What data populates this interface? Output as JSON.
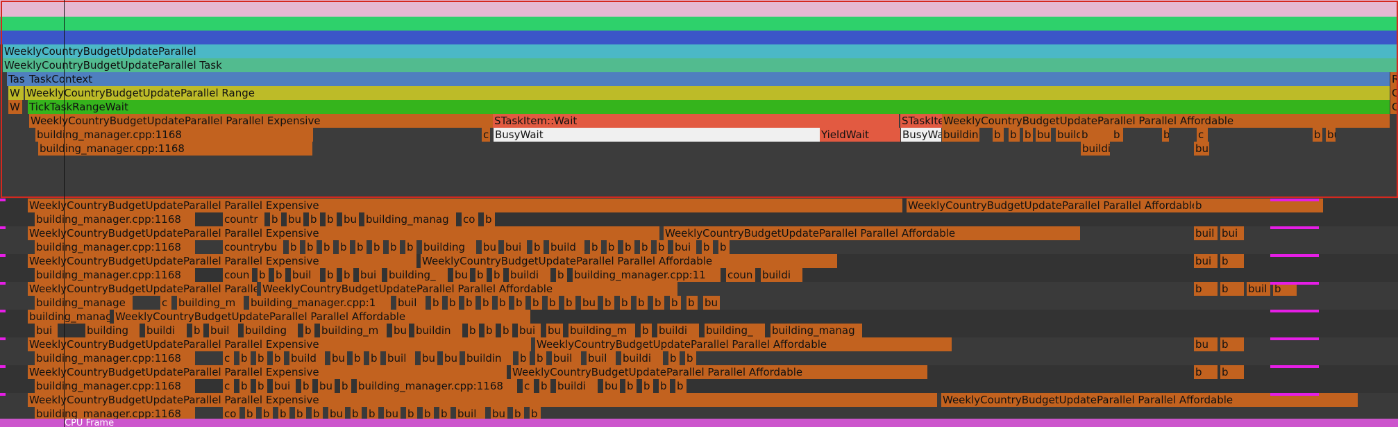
{
  "colors": {
    "background": "#3c3c3c",
    "selection_border": "#d4281e",
    "task_orange": "#c2621f",
    "task_orange_light": "#d4772c",
    "dark_gap": "#2a2a2a",
    "wait_red": "#e25a41",
    "busy_white": "#f0f0f0",
    "yellow_green": "#bdbb28",
    "green": "#35b41c",
    "steel_blue": "#4f7fbf",
    "teal": "#49b8b0",
    "magenta": "#e51ee5"
  },
  "icons": {
    "cursor_line": "vertical-cursor-line",
    "selection_frame": "selection-rectangle"
  },
  "thread0": {
    "weekly_parallel": "WeeklyCountryBudgetUpdateParallel",
    "weekly_parallel_task": "WeeklyCountryBudgetUpdateParallel Task",
    "task_context_short": "Tas",
    "task_context": "TaskContext",
    "range_w": "W",
    "range": "WeeklyCountryBudgetUpdateParallel Range",
    "tick_w": "W",
    "tick_wait": "TickTaskRangeWait",
    "expensive": "WeeklyCountryBudgetUpdateParallel Parallel Expensive",
    "building_line": "building_manager.cpp:1168",
    "building_line_2": "building_manager.cpp:1168",
    "c": "c",
    "stask_wait": "STaskItem::Wait",
    "busy_wait": "BusyWait",
    "yield_wait": "YieldWait",
    "stask_short": "STaskIte",
    "busy_short": "BusyWai",
    "affordable": "WeeklyCountryBudgetUpdateParallel Parallel Affordable",
    "sub": [
      "buildin",
      "b",
      "b",
      "b",
      "bu",
      "buildi",
      "b",
      "b",
      "bui",
      "c",
      "b",
      "bu"
    ],
    "sub2": [
      "buildi",
      "bu"
    ],
    "right_r": "R",
    "right_c1": "C",
    "right_c2": "C"
  },
  "threads": [
    {
      "row1": [
        "WeeklyCountryBudgetUpdateParallel Parallel Expensive",
        "WeeklyCountryBudgetUpdateParallel Parallel Affordable",
        "b"
      ],
      "row2": [
        "building_manager.cpp:1168",
        "countr",
        "b",
        "bu",
        "b",
        "b",
        "bu",
        "building_manag",
        "co",
        "b"
      ]
    },
    {
      "row1": [
        "WeeklyCountryBudgetUpdateParallel Parallel Expensive",
        "WeeklyCountryBudgetUpdateParallel Parallel Affordable",
        "buil",
        "bui"
      ],
      "row2": [
        "building_manager.cpp:1168",
        "countrybu",
        "b",
        "b",
        "b",
        "b",
        "b",
        "b",
        "b",
        "b",
        "building",
        "bu",
        "bui",
        "b",
        "build",
        "b",
        "b",
        "b",
        "b",
        "b",
        "bui",
        "b",
        "b"
      ]
    },
    {
      "row1": [
        "WeeklyCountryBudgetUpdateParallel Parallel Expensive",
        "WeeklyCountryBudgetUpdateParallel Parallel Affordable",
        "bui",
        "b"
      ],
      "row2": [
        "building_manager.cpp:1168",
        "coun",
        "b",
        "b",
        "buil",
        "b",
        "b",
        "bui",
        "building_",
        "bu",
        "b",
        "b",
        "buildi",
        "b",
        "building_manager.cpp:11",
        "coun",
        "buildi"
      ]
    },
    {
      "row1": [
        "WeeklyCountryBudgetUpdateParallel Parallel Ex",
        "WeeklyCountryBudgetUpdateParallel Parallel Affordable",
        "b",
        "b",
        "buil",
        "b"
      ],
      "row2": [
        "building_manage",
        "c",
        "building_m",
        "building_manager.cpp:1",
        "buil",
        "b",
        "b",
        "b",
        "b",
        "b",
        "b",
        "b",
        "b",
        "b",
        "bu",
        "b",
        "b",
        "b",
        "b",
        "b",
        "b",
        "bu"
      ]
    },
    {
      "row1": [
        "building_manag",
        "WeeklyCountryBudgetUpdateParallel Parallel Affordable"
      ],
      "row2": [
        "bui",
        "building",
        "buildi",
        "b",
        "buil",
        "building",
        "b",
        "building_m",
        "bu",
        "buildin",
        "b",
        "b",
        "b",
        "bui",
        "bu",
        "building_m",
        "b",
        "buildi",
        "building_",
        "building_manag"
      ]
    },
    {
      "row1": [
        "WeeklyCountryBudgetUpdateParallel Parallel Expensive",
        "WeeklyCountryBudgetUpdateParallel Parallel Affordable",
        "bu",
        "b"
      ],
      "row2": [
        "building_manager.cpp:1168",
        "c",
        "b",
        "b",
        "b",
        "build",
        "bu",
        "b",
        "b",
        "buil",
        "bu",
        "bu",
        "buildin",
        "b",
        "b",
        "buil",
        "buil",
        "buildi",
        "b",
        "b"
      ]
    },
    {
      "row1": [
        "WeeklyCountryBudgetUpdateParallel Parallel Expensive",
        "WeeklyCountryBudgetUpdateParallel Parallel Affordable",
        "b",
        "b"
      ],
      "row2": [
        "building_manager.cpp:1168",
        "c",
        "b",
        "b",
        "bui",
        "b",
        "bu",
        "b",
        "building_manager.cpp:1168",
        "c",
        "b",
        "buildi",
        "bu",
        "b",
        "b",
        "b",
        "b"
      ]
    },
    {
      "row1": [
        "WeeklyCountryBudgetUpdateParallel Parallel Expensive",
        "WeeklyCountryBudgetUpdateParallel Parallel Affordable"
      ],
      "row2": [
        "building_manager.cpp:1168",
        "co",
        "b",
        "b",
        "b",
        "b",
        "b",
        "bu",
        "b",
        "b",
        "bu",
        "b",
        "b",
        "b",
        "buil",
        "bu",
        "b",
        "b"
      ]
    }
  ],
  "footer": {
    "cpu_frame": "CPU Frame"
  }
}
